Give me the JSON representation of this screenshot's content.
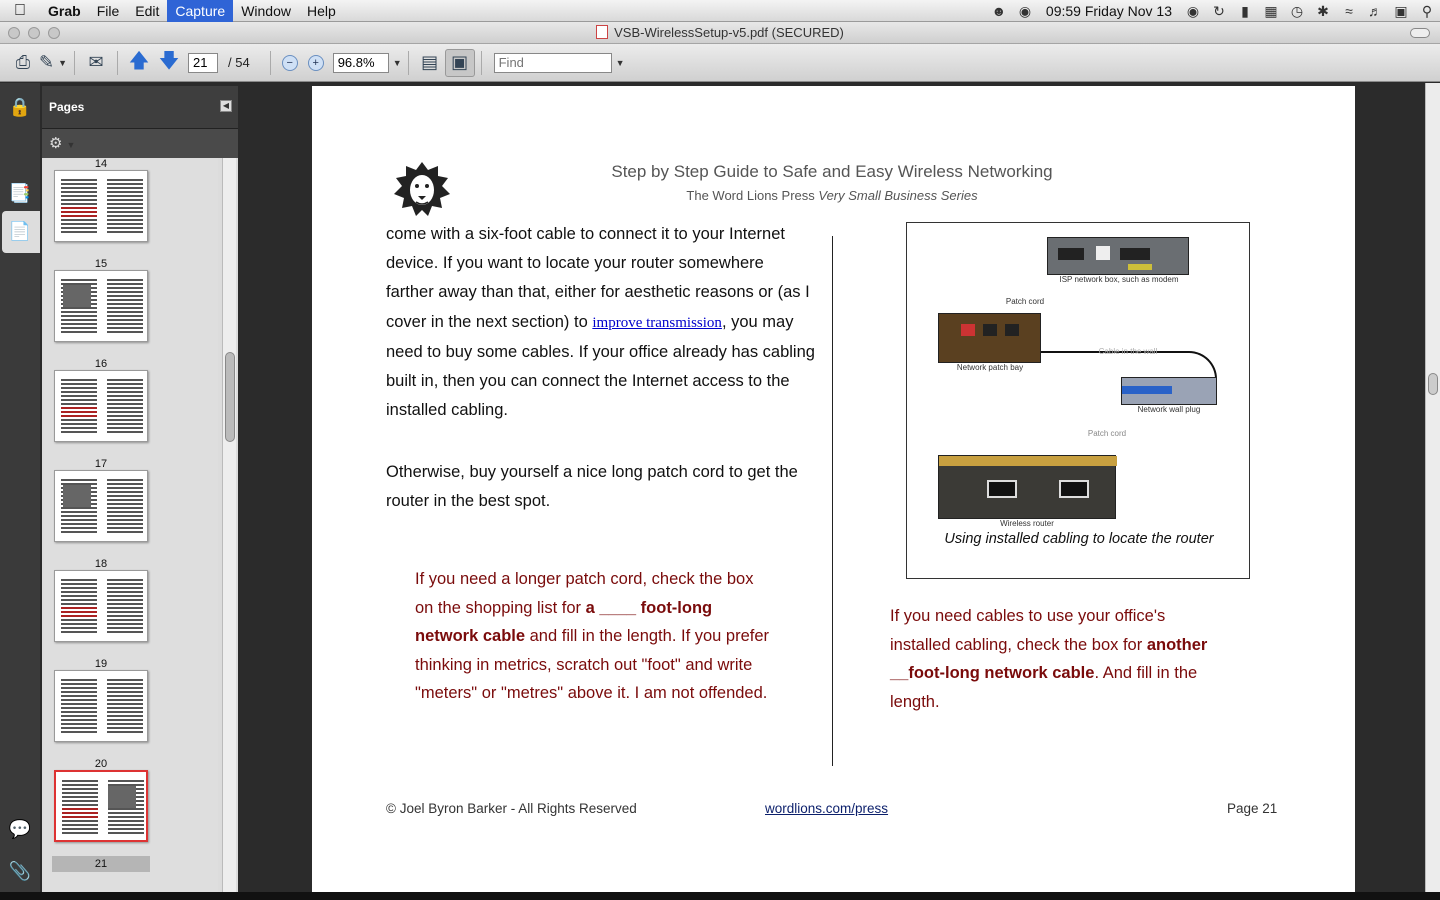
{
  "menubar": {
    "apple": "",
    "items": [
      "Grab",
      "File",
      "Edit",
      "Capture",
      "Window",
      "Help"
    ],
    "clock": "09:59 Friday Nov 13"
  },
  "window": {
    "title": "VSB-WirelessSetup-v5.pdf (SECURED)"
  },
  "toolbar": {
    "current_page": "21",
    "page_total": "/  54",
    "zoom": "96.8%",
    "find_placeholder": "Find"
  },
  "pages_panel": {
    "title": "Pages",
    "thumb_labels": [
      "14",
      "15",
      "16",
      "17",
      "18",
      "19",
      "20",
      "21"
    ],
    "current_page": "21"
  },
  "document": {
    "header_title": "Step by Step Guide to Safe and Easy Wireless Networking",
    "header_sub_plain": "The Word Lions Press ",
    "header_sub_italic": "Very Small Business Series",
    "para1_a": "come with a six-foot cable to connect it to your Internet device.  If you want to locate your router somewhere farther away than that, either for aesthetic reasons or (as I cover in the next section) to ",
    "para1_link": "improve transmission",
    "para1_b": ", you may need to buy some cables.  If your office already has cabling built in, then you can connect the Internet access to the installed cabling.",
    "para2": "Otherwise, buy yourself a nice long patch cord to get the router in the best spot.",
    "callout1_a": "If you need a longer patch cord, check the box on the shopping list for ",
    "callout1_bold": "a ____ foot-long network cable",
    "callout1_b": " and fill in the length. If you prefer thinking in metrics, scratch out \"foot\" and write \"meters\" or \"metres\" above it.  I am not offended.",
    "callout2_a": "If you need cables to use your office's installed cabling, check the box for ",
    "callout2_bold": "another __foot-long network cable",
    "callout2_b": ". And fill in the length.",
    "figure": {
      "label_isp": "ISP network box, such as modem",
      "label_patchcord1": "Patch cord",
      "label_patchbay": "Network patch bay",
      "label_cable": "Cable in the wall",
      "label_wallplug": "Network wall plug",
      "label_patchcord2": "Patch cord",
      "label_router": "Wireless router",
      "caption": "Using installed cabling to locate the router"
    },
    "footer_copy": "© Joel Byron Barker - All Rights Reserved",
    "footer_link": "wordlions.com/press",
    "footer_page": "Page 21"
  },
  "colors": {
    "callout_text": "#7a0b0b",
    "link": "#0000cc",
    "menu_active": "#2f64d6",
    "current_thumb_border": "#dd3333"
  }
}
